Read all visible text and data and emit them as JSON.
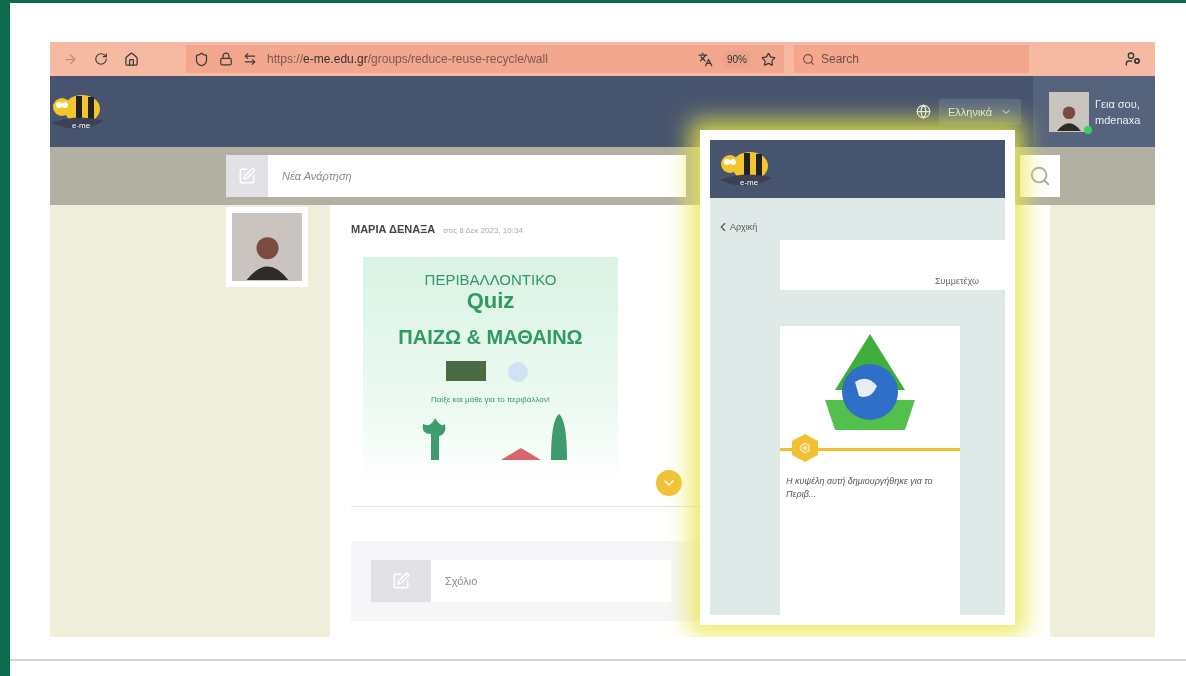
{
  "browser": {
    "forward_disabled": true,
    "url": {
      "scheme": "https://",
      "host": "e-me.edu.gr",
      "path": "/groups/reduce-reuse-recycle/wall"
    },
    "zoom": "90%",
    "search": {
      "placeholder": "Search"
    }
  },
  "header": {
    "logo": "e-me",
    "language": "Ελληνικά",
    "greeting": "Γεια σου,",
    "username": "mdenaxa",
    "online": true
  },
  "composer": {
    "placeholder": "Νέα Ανάρτηση"
  },
  "post": {
    "author": "ΜΑΡΙΑ ΔΕΝΑΞΑ",
    "time": "στις 8 Δεκ 2023, 10:34",
    "image": {
      "title": "ΠΕΡΙΒΑΛΛΟΝΤΙΚΟ",
      "subtitle": "Quiz",
      "headline": "ΠΑΙΖΩ & ΜΑΘΑΙΝΩ",
      "tagline": "Παίξε και μάθε για το περιβάλλον!"
    }
  },
  "comment": {
    "placeholder": "Σχόλιο"
  },
  "inset": {
    "logo": "e-me",
    "back_link": "Αρχική",
    "join": "Συμμετέχω",
    "hive_description": "Η κυψέλη αυτή δημιουργήθηκε για το Περιβ..."
  }
}
